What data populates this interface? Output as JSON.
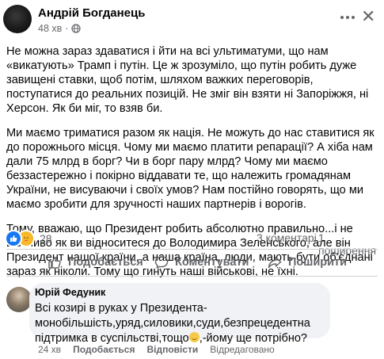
{
  "post": {
    "author": "Андрій Богданець",
    "time": "48 хв",
    "dot": "·",
    "paragraphs": [
      "Не можна зараз здаватися і йти на всі ультиматуми, що нам «викатують» Трамп і путін. Це ж зрозуміло, що путін робить дуже завищені ставки, щоб потім, шляхом важких переговорів, поступатися до реальних позицій. Не зміг він взяти ні Запоріжжя, ні Херсон. Як би міг, то взяв би.",
      "Ми маємо триматися разом як нація. Не можуть до нас ставитися як до порожнього  місця. Чому ми маємо платити репарації? А хіба нам дали 75 млрд в борг? Чи в борг пару млрд? Чому ми маємо беззастережно і покірно віддавати те, що належить громадянам України, не висуваючи і своїх умов? Нам постійно говорять, що ми маємо зробити для зручності наших партнерів і ворогів.",
      "Тому, вважаю, що Президент робить абсолютно правильно...і не важливо як ви відноситеся до Володимира Зеленського, але він Президент нашої країни, а наша країна, люди, мають бути об'єднані зараз як ніколи. Тому що гинуть наші військові, не їхні."
    ],
    "reaction_count": "28",
    "comments_count": "3 коментарі",
    "shares_count": "1 поширення"
  },
  "actions": {
    "like": "Подобається",
    "comment": "Коментувати",
    "share": "Поширити"
  },
  "comment": {
    "author": "Юрій Федуник",
    "text_before_emoji": "Всі козирі в руках у Президента-монобільшість,уряд,силовики,суди,безпрецедентна підтримка в суспільстві,тощо",
    "text_after_emoji": ",-йому ще потрібно?",
    "time": "24 хв",
    "like": "Подобається",
    "reply": "Відповісти",
    "hide": "Відредаговано"
  },
  "icons": [
    "globe-icon",
    "more-icon",
    "close-icon",
    "like-reaction-icon",
    "care-reaction-icon",
    "thumbs-up-icon",
    "comment-icon",
    "share-icon",
    "emoji-icon"
  ],
  "colors": {
    "accent": "#1877f2",
    "muted": "#65676b",
    "bubble": "#f0f2f5"
  }
}
